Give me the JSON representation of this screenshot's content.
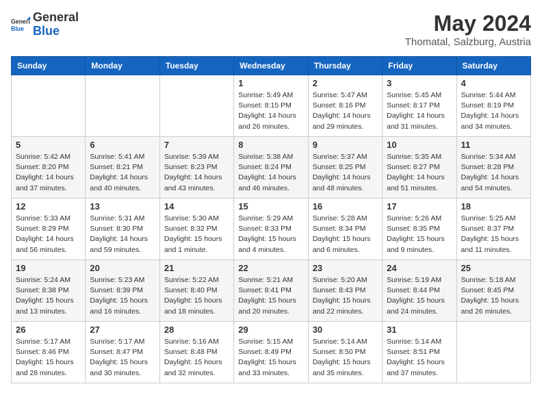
{
  "header": {
    "logo_general": "General",
    "logo_blue": "Blue",
    "month_year": "May 2024",
    "location": "Thomatal, Salzburg, Austria"
  },
  "days_of_week": [
    "Sunday",
    "Monday",
    "Tuesday",
    "Wednesday",
    "Thursday",
    "Friday",
    "Saturday"
  ],
  "weeks": [
    [
      {
        "day": "",
        "sunrise": "",
        "sunset": "",
        "daylight": ""
      },
      {
        "day": "",
        "sunrise": "",
        "sunset": "",
        "daylight": ""
      },
      {
        "day": "",
        "sunrise": "",
        "sunset": "",
        "daylight": ""
      },
      {
        "day": "1",
        "sunrise": "Sunrise: 5:49 AM",
        "sunset": "Sunset: 8:15 PM",
        "daylight": "Daylight: 14 hours and 26 minutes."
      },
      {
        "day": "2",
        "sunrise": "Sunrise: 5:47 AM",
        "sunset": "Sunset: 8:16 PM",
        "daylight": "Daylight: 14 hours and 29 minutes."
      },
      {
        "day": "3",
        "sunrise": "Sunrise: 5:45 AM",
        "sunset": "Sunset: 8:17 PM",
        "daylight": "Daylight: 14 hours and 31 minutes."
      },
      {
        "day": "4",
        "sunrise": "Sunrise: 5:44 AM",
        "sunset": "Sunset: 8:19 PM",
        "daylight": "Daylight: 14 hours and 34 minutes."
      }
    ],
    [
      {
        "day": "5",
        "sunrise": "Sunrise: 5:42 AM",
        "sunset": "Sunset: 8:20 PM",
        "daylight": "Daylight: 14 hours and 37 minutes."
      },
      {
        "day": "6",
        "sunrise": "Sunrise: 5:41 AM",
        "sunset": "Sunset: 8:21 PM",
        "daylight": "Daylight: 14 hours and 40 minutes."
      },
      {
        "day": "7",
        "sunrise": "Sunrise: 5:39 AM",
        "sunset": "Sunset: 8:23 PM",
        "daylight": "Daylight: 14 hours and 43 minutes."
      },
      {
        "day": "8",
        "sunrise": "Sunrise: 5:38 AM",
        "sunset": "Sunset: 8:24 PM",
        "daylight": "Daylight: 14 hours and 46 minutes."
      },
      {
        "day": "9",
        "sunrise": "Sunrise: 5:37 AM",
        "sunset": "Sunset: 8:25 PM",
        "daylight": "Daylight: 14 hours and 48 minutes."
      },
      {
        "day": "10",
        "sunrise": "Sunrise: 5:35 AM",
        "sunset": "Sunset: 8:27 PM",
        "daylight": "Daylight: 14 hours and 51 minutes."
      },
      {
        "day": "11",
        "sunrise": "Sunrise: 5:34 AM",
        "sunset": "Sunset: 8:28 PM",
        "daylight": "Daylight: 14 hours and 54 minutes."
      }
    ],
    [
      {
        "day": "12",
        "sunrise": "Sunrise: 5:33 AM",
        "sunset": "Sunset: 8:29 PM",
        "daylight": "Daylight: 14 hours and 56 minutes."
      },
      {
        "day": "13",
        "sunrise": "Sunrise: 5:31 AM",
        "sunset": "Sunset: 8:30 PM",
        "daylight": "Daylight: 14 hours and 59 minutes."
      },
      {
        "day": "14",
        "sunrise": "Sunrise: 5:30 AM",
        "sunset": "Sunset: 8:32 PM",
        "daylight": "Daylight: 15 hours and 1 minute."
      },
      {
        "day": "15",
        "sunrise": "Sunrise: 5:29 AM",
        "sunset": "Sunset: 8:33 PM",
        "daylight": "Daylight: 15 hours and 4 minutes."
      },
      {
        "day": "16",
        "sunrise": "Sunrise: 5:28 AM",
        "sunset": "Sunset: 8:34 PM",
        "daylight": "Daylight: 15 hours and 6 minutes."
      },
      {
        "day": "17",
        "sunrise": "Sunrise: 5:26 AM",
        "sunset": "Sunset: 8:35 PM",
        "daylight": "Daylight: 15 hours and 9 minutes."
      },
      {
        "day": "18",
        "sunrise": "Sunrise: 5:25 AM",
        "sunset": "Sunset: 8:37 PM",
        "daylight": "Daylight: 15 hours and 11 minutes."
      }
    ],
    [
      {
        "day": "19",
        "sunrise": "Sunrise: 5:24 AM",
        "sunset": "Sunset: 8:38 PM",
        "daylight": "Daylight: 15 hours and 13 minutes."
      },
      {
        "day": "20",
        "sunrise": "Sunrise: 5:23 AM",
        "sunset": "Sunset: 8:39 PM",
        "daylight": "Daylight: 15 hours and 16 minutes."
      },
      {
        "day": "21",
        "sunrise": "Sunrise: 5:22 AM",
        "sunset": "Sunset: 8:40 PM",
        "daylight": "Daylight: 15 hours and 18 minutes."
      },
      {
        "day": "22",
        "sunrise": "Sunrise: 5:21 AM",
        "sunset": "Sunset: 8:41 PM",
        "daylight": "Daylight: 15 hours and 20 minutes."
      },
      {
        "day": "23",
        "sunrise": "Sunrise: 5:20 AM",
        "sunset": "Sunset: 8:43 PM",
        "daylight": "Daylight: 15 hours and 22 minutes."
      },
      {
        "day": "24",
        "sunrise": "Sunrise: 5:19 AM",
        "sunset": "Sunset: 8:44 PM",
        "daylight": "Daylight: 15 hours and 24 minutes."
      },
      {
        "day": "25",
        "sunrise": "Sunrise: 5:18 AM",
        "sunset": "Sunset: 8:45 PM",
        "daylight": "Daylight: 15 hours and 26 minutes."
      }
    ],
    [
      {
        "day": "26",
        "sunrise": "Sunrise: 5:17 AM",
        "sunset": "Sunset: 8:46 PM",
        "daylight": "Daylight: 15 hours and 28 minutes."
      },
      {
        "day": "27",
        "sunrise": "Sunrise: 5:17 AM",
        "sunset": "Sunset: 8:47 PM",
        "daylight": "Daylight: 15 hours and 30 minutes."
      },
      {
        "day": "28",
        "sunrise": "Sunrise: 5:16 AM",
        "sunset": "Sunset: 8:48 PM",
        "daylight": "Daylight: 15 hours and 32 minutes."
      },
      {
        "day": "29",
        "sunrise": "Sunrise: 5:15 AM",
        "sunset": "Sunset: 8:49 PM",
        "daylight": "Daylight: 15 hours and 33 minutes."
      },
      {
        "day": "30",
        "sunrise": "Sunrise: 5:14 AM",
        "sunset": "Sunset: 8:50 PM",
        "daylight": "Daylight: 15 hours and 35 minutes."
      },
      {
        "day": "31",
        "sunrise": "Sunrise: 5:14 AM",
        "sunset": "Sunset: 8:51 PM",
        "daylight": "Daylight: 15 hours and 37 minutes."
      },
      {
        "day": "",
        "sunrise": "",
        "sunset": "",
        "daylight": ""
      }
    ]
  ]
}
